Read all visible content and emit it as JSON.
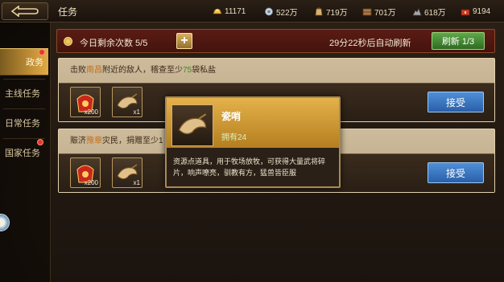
{
  "header": {
    "title": "任务",
    "resources": [
      {
        "icon": "gold-ingot-icon",
        "value": "11171"
      },
      {
        "icon": "silver-coin-icon",
        "value": "522万"
      },
      {
        "icon": "grain-sack-icon",
        "value": "719万"
      },
      {
        "icon": "wood-crate-icon",
        "value": "701万"
      },
      {
        "icon": "stone-ore-icon",
        "value": "618万"
      },
      {
        "icon": "treasure-chest-icon",
        "value": "9194"
      }
    ]
  },
  "sidebar": {
    "items": [
      {
        "label": "政务",
        "active": true,
        "badge": true
      },
      {
        "label": "主线任务",
        "active": false,
        "badge": false
      },
      {
        "label": "日常任务",
        "active": false,
        "badge": false
      },
      {
        "label": "国家任务",
        "active": false,
        "badge": true
      }
    ]
  },
  "count_bar": {
    "label": "今日剩余次数 5/5",
    "plus": "+",
    "refresh_text": "29分22秒后自动刷新",
    "refresh_button": "刷新 1/3"
  },
  "tasks": [
    {
      "desc_prefix": "击败",
      "place": "南昌",
      "desc_mid": "附近的敌人，稽查至少",
      "amount": "75",
      "desc_suffix": "袋私盐",
      "rewards": [
        {
          "icon": "red-pouch-icon",
          "qty": "x200"
        },
        {
          "icon": "horn-whistle-icon",
          "qty": "x1"
        }
      ],
      "accept": "接受"
    },
    {
      "desc_prefix": "赈济",
      "place": "豫章",
      "desc_mid": "灾民，捐赠至少1",
      "amount": "",
      "desc_suffix": "",
      "rewards": [
        {
          "icon": "red-pouch-icon",
          "qty": "x200"
        },
        {
          "icon": "horn-whistle-icon",
          "qty": "x1"
        }
      ],
      "accept": "接受"
    }
  ],
  "tooltip": {
    "name": "瓷哨",
    "owned": "拥有24",
    "description": "资源点道具，用于牧场放牧，可获得大量武将碎片，响声嘹亮，驯教有方，猛兽皆臣服"
  },
  "colors": {
    "accent_gold": "#e4b14a",
    "accept_blue": "#3a78c4",
    "refresh_green": "#4a8f38",
    "badge_red": "#e43a2a"
  }
}
